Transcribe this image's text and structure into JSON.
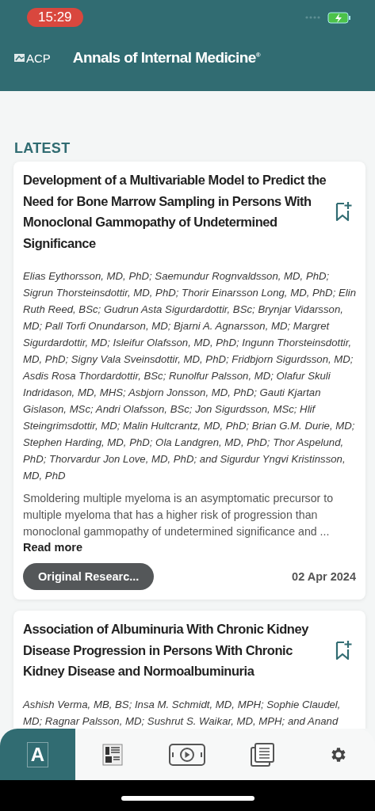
{
  "status_bar": {
    "time": "15:29"
  },
  "header": {
    "logo": "ACP",
    "title": "Annals of Internal Medicine$^{®}$"
  },
  "section_title": "LATEST",
  "articles": [
    {
      "title": "Development of a Multivariable Model to Predict the Need for Bone Marrow Sampling in Persons With Monoclonal Gammopathy of Undetermined Significance",
      "authors": "Elias Eythorsson, MD, PhD; Saemundur Rognvaldsson, MD, PhD; Sigrun Thorsteinsdottir, MD, PhD; Thorir Einarsson Long, MD, PhD; Elin Ruth Reed, BSc; Gudrun Asta Sigurdardottir, BSc; Brynjar Vidarsson, MD; Pall Torfi Onundarson, MD; Bjarni A. Agnarsson, MD; Margret Sigurdardottir, MD; Isleifur Olafsson, MD, PhD; Ingunn Thorsteinsdottir, MD, PhD; Signy Vala Sveinsdottir, MD, PhD; Fridbjorn Sigurdsson, MD; Asdis Rosa Thordardottir, BSc; Runolfur Palsson, MD; Olafur Skuli Indridason, MD, MHS; Asbjorn Jonsson, MD, PhD; Gauti Kjartan Gislason, MSc; Andri Olafsson, BSc; Jon Sigurdsson, MSc; Hlif Steingrimsdottir, MD; Malin Hultcrantz, MD, PhD; Brian G.M. Durie, MD; Stephen Harding, MD, PhD; Ola Landgren, MD, PhD; Thor Aspelund, PhD; Thorvardur Jon Love, MD, PhD; and Sigurdur Yngvi Kristinsson, MD, PhD",
      "abstract": "Smoldering multiple myeloma is an asymptomatic precursor to multiple myeloma that has a higher risk of progression than monoclonal gammopathy of undetermined significance and ...",
      "read_more": "Read more",
      "category": "Original Researc...",
      "date": "02 Apr 2024"
    },
    {
      "title": "Association of Albuminuria With Chronic Kidney Disease Progression in Persons With Chronic Kidney Disease and Normoalbuminuria",
      "authors": "Ashish Verma, MB, BS; Insa M. Schmidt, MD, MPH; Sophie Claudel, MD; Ragnar Palsson, MD; Sushrut S. Waikar, MD, MPH; and Anand"
    }
  ],
  "tab_bar": [
    {
      "kind": "logo",
      "label": "A",
      "selected": true
    },
    {
      "kind": "issue",
      "selected": false
    },
    {
      "kind": "video",
      "selected": false
    },
    {
      "kind": "collection",
      "selected": false
    },
    {
      "kind": "settings",
      "selected": false
    }
  ]
}
